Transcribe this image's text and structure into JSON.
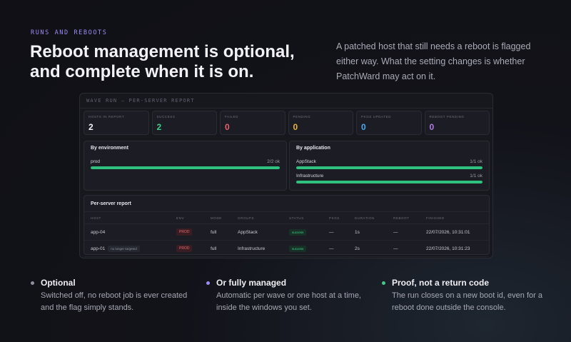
{
  "eyebrow": "RUNS AND REBOOTS",
  "headline": {
    "line1": "Reboot management is optional,",
    "line2": "and complete when it is on."
  },
  "intro": "A patched host that still needs a reboot is flagged either way. What the setting changes is whether PatchWard may act on it.",
  "panel": {
    "title": "WAVE RUN — PER-SERVER REPORT",
    "stats": [
      {
        "label": "HOSTS IN REPORT",
        "value": "2",
        "color": "#f2f2f6"
      },
      {
        "label": "SUCCESS",
        "value": "2",
        "color": "#3fcf8a"
      },
      {
        "label": "FAILED",
        "value": "0",
        "color": "#e5606b"
      },
      {
        "label": "PENDING",
        "value": "0",
        "color": "#e8b43a"
      },
      {
        "label": "PKGS UPDATED",
        "value": "0",
        "color": "#4aa8f0"
      },
      {
        "label": "REBOOT PENDING",
        "value": "0",
        "color": "#b07ae8"
      }
    ],
    "by_environment": {
      "title": "By environment",
      "rows": [
        {
          "name": "prod",
          "value": "2/2 ok",
          "fraction": 1.0
        }
      ]
    },
    "by_application": {
      "title": "By application",
      "rows": [
        {
          "name": "AppStack",
          "value": "1/1 ok",
          "fraction": 1.0
        },
        {
          "name": "Infrastructure",
          "value": "1/1 ok",
          "fraction": 1.0
        }
      ]
    },
    "report": {
      "title": "Per-server report",
      "columns": [
        "HOST",
        "ENV",
        "MODE",
        "GROUPS",
        "STATUS",
        "PKGS",
        "DURATION",
        "REBOOT",
        "FINISHED"
      ],
      "rows": [
        {
          "host": "app-04",
          "note": "",
          "env": "PROD",
          "mode": "full",
          "groups": "AppStack",
          "status": "success",
          "pkgs": "—",
          "duration": "1s",
          "reboot": "—",
          "finished": "22/07/2026, 10:31:01"
        },
        {
          "host": "app-01",
          "note": "no longer targeted",
          "env": "PROD",
          "mode": "full",
          "groups": "Infrastructure",
          "status": "success",
          "pkgs": "—",
          "duration": "2s",
          "reboot": "—",
          "finished": "22/07/2026, 10:31:23"
        }
      ]
    }
  },
  "features": [
    {
      "title": "Optional",
      "text": "Switched off, no reboot job is ever created and the flag simply stands.",
      "dot_color": "#8e909c"
    },
    {
      "title": "Or fully managed",
      "text": "Automatic per wave or one host at a time, inside the windows you set.",
      "dot_color": "#9d8cf5"
    },
    {
      "title": "Proof, not a return code",
      "text": "The run closes on a new boot id, even for a reboot done outside the console.",
      "dot_color": "#46c88c"
    }
  ]
}
